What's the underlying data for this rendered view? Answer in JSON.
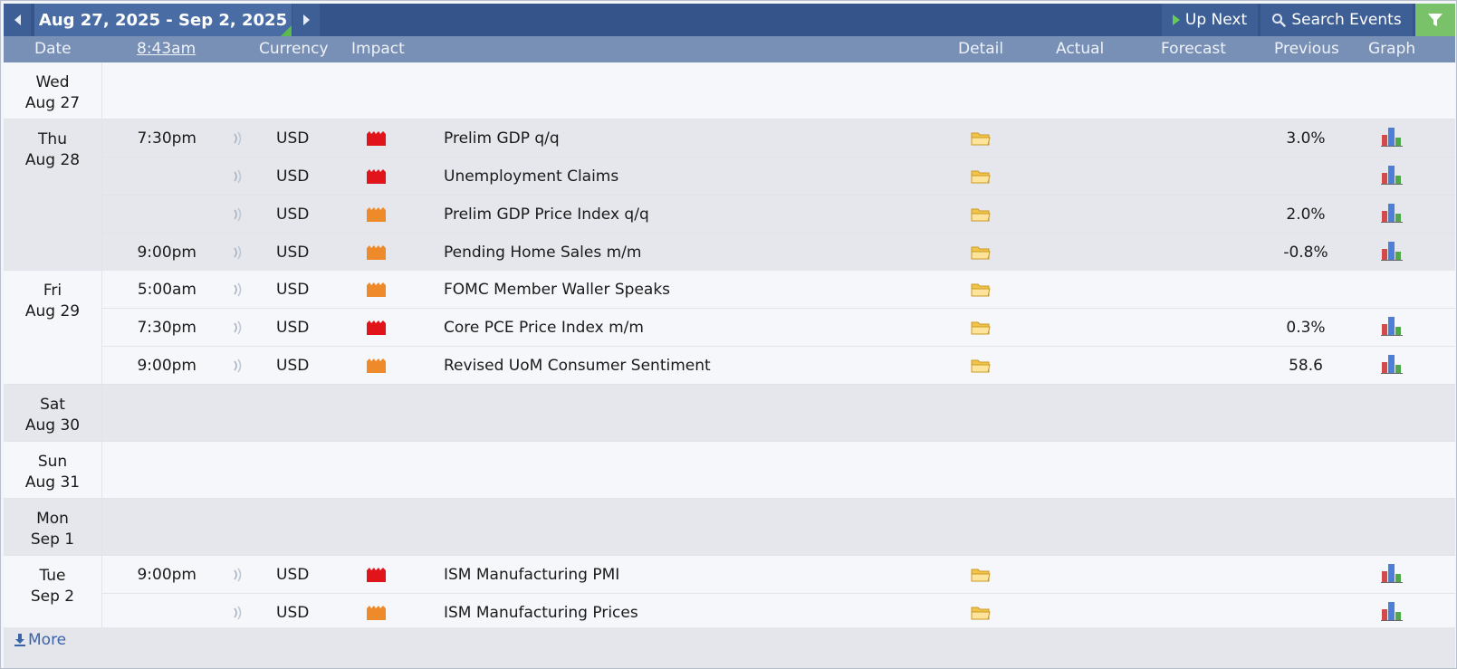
{
  "toolbar": {
    "date_range": "Aug 27, 2025 - Sep 2, 2025",
    "up_next_label": "Up Next",
    "search_label": "Search Events"
  },
  "header": {
    "date": "Date",
    "current_time": "8:43am",
    "currency": "Currency",
    "impact": "Impact",
    "detail": "Detail",
    "actual": "Actual",
    "forecast": "Forecast",
    "previous": "Previous",
    "graph": "Graph"
  },
  "colors": {
    "high_impact": "#e0141a",
    "medium_impact": "#ee8a2a",
    "header_bg": "#7890b6",
    "topbar_bg": "#34548a"
  },
  "days": [
    {
      "weekday": "Wed",
      "date": "Aug 27",
      "events": []
    },
    {
      "weekday": "Thu",
      "date": "Aug 28",
      "events": [
        {
          "time": "7:30pm",
          "currency": "USD",
          "impact": "high",
          "name": "Prelim GDP q/q",
          "previous": "3.0%",
          "graph": true
        },
        {
          "time": "",
          "currency": "USD",
          "impact": "high",
          "name": "Unemployment Claims",
          "previous": "",
          "graph": true
        },
        {
          "time": "",
          "currency": "USD",
          "impact": "medium",
          "name": "Prelim GDP Price Index q/q",
          "previous": "2.0%",
          "graph": true
        },
        {
          "time": "9:00pm",
          "currency": "USD",
          "impact": "medium",
          "name": "Pending Home Sales m/m",
          "previous": "-0.8%",
          "graph": true
        }
      ]
    },
    {
      "weekday": "Fri",
      "date": "Aug 29",
      "events": [
        {
          "time": "5:00am",
          "currency": "USD",
          "impact": "medium",
          "name": "FOMC Member Waller Speaks",
          "previous": "",
          "graph": false
        },
        {
          "time": "7:30pm",
          "currency": "USD",
          "impact": "high",
          "name": "Core PCE Price Index m/m",
          "previous": "0.3%",
          "graph": true
        },
        {
          "time": "9:00pm",
          "currency": "USD",
          "impact": "medium",
          "name": "Revised UoM Consumer Sentiment",
          "previous": "58.6",
          "graph": true
        }
      ]
    },
    {
      "weekday": "Sat",
      "date": "Aug 30",
      "events": []
    },
    {
      "weekday": "Sun",
      "date": "Aug 31",
      "events": []
    },
    {
      "weekday": "Mon",
      "date": "Sep 1",
      "events": []
    },
    {
      "weekday": "Tue",
      "date": "Sep 2",
      "events": [
        {
          "time": "9:00pm",
          "currency": "USD",
          "impact": "high",
          "name": "ISM Manufacturing PMI",
          "previous": "",
          "graph": true
        },
        {
          "time": "",
          "currency": "USD",
          "impact": "medium",
          "name": "ISM Manufacturing Prices",
          "previous": "",
          "graph": true
        }
      ]
    }
  ],
  "footer": {
    "more_label": "More"
  }
}
